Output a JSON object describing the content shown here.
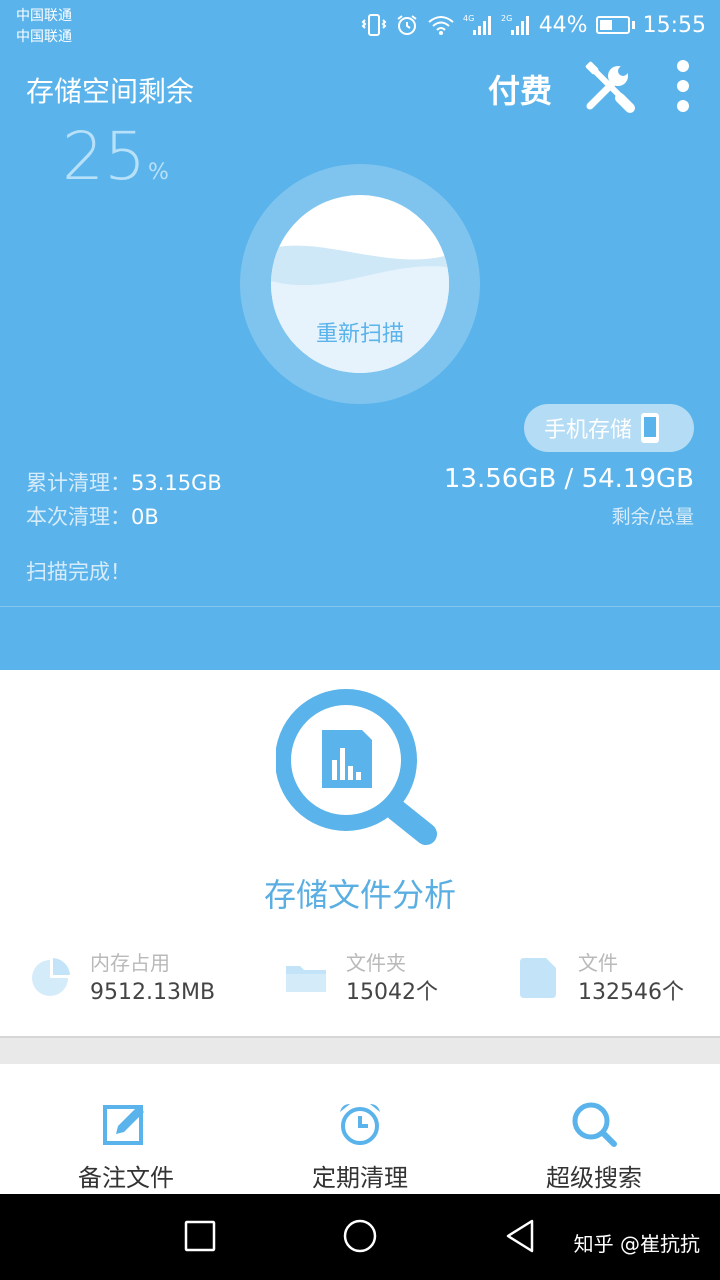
{
  "status_bar": {
    "carrier_1": "中国联通",
    "carrier_2": "中国联通",
    "network_1": "4G",
    "network_2": "2G",
    "battery": "44%",
    "time": "15:55"
  },
  "header": {
    "title": "存储空间剩余",
    "pay_label": "付费",
    "tools_icon": "wrench-screwdriver-icon",
    "menu_icon": "more-vertical-icon"
  },
  "storage": {
    "percent_value": "25",
    "percent_unit": "%",
    "remaining_fraction": 0.25,
    "rescan_label": "重新扫描",
    "phone_storage_label": "手机存储",
    "total_text": "13.56GB / 54.19GB",
    "total_sub": "剩余/总量",
    "cumulative_label": "累计清理：",
    "cumulative_value": "53.15GB",
    "this_time_label": "本次清理：",
    "this_time_value": "0B",
    "scan_status": "扫描完成！"
  },
  "analysis": {
    "title": "存储文件分析",
    "metrics": [
      {
        "icon": "pie-chart-icon",
        "label": "内存占用",
        "value": "9512.13MB"
      },
      {
        "icon": "folder-icon",
        "label": "文件夹",
        "value": "15042个"
      },
      {
        "icon": "file-icon",
        "label": "文件",
        "value": "132546个"
      }
    ]
  },
  "tools": [
    {
      "icon": "edit-note-icon",
      "label": "备注文件"
    },
    {
      "icon": "alarm-clock-icon",
      "label": "定期清理"
    },
    {
      "icon": "search-icon",
      "label": "超级搜索"
    }
  ],
  "nav": {
    "watermark": "知乎 @崔抗抗"
  },
  "colors": {
    "primary": "#5ab3ea",
    "primary_light": "#b4dcf5",
    "accent_text": "#5aaee2"
  }
}
